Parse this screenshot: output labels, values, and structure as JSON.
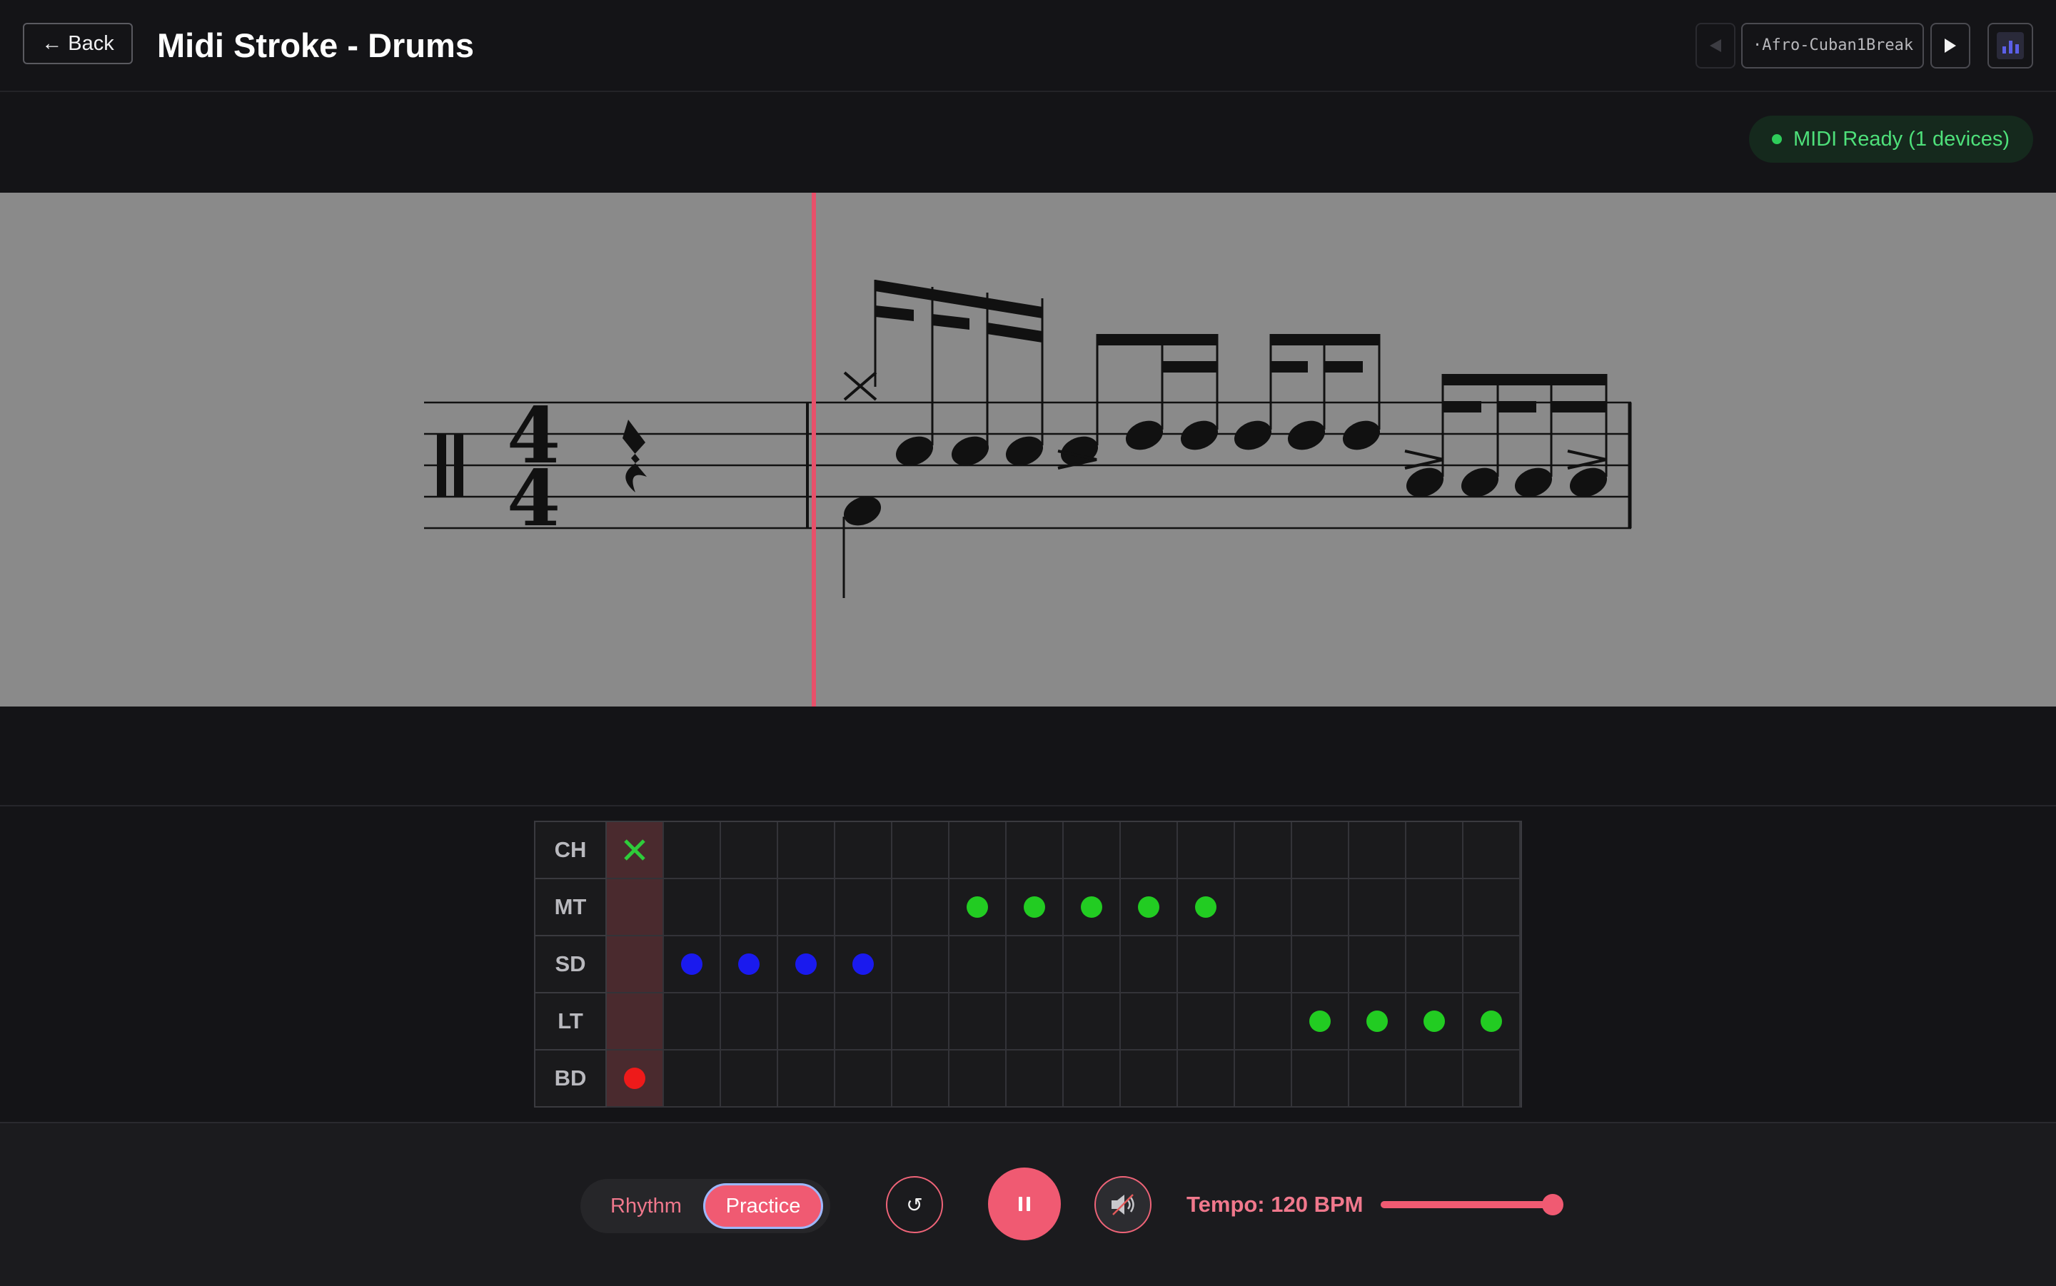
{
  "header": {
    "back_label": "← Back",
    "title": "Midi Stroke - Drums",
    "song_selector_value": "·Afro-Cuban1Break",
    "icons": {
      "prev": "triangle-left-icon",
      "next": "play-triangle-icon",
      "visualizer": "bar-chart-icon"
    }
  },
  "midi_status": {
    "text": "MIDI Ready (1 devices)",
    "color": "#2ecc5a"
  },
  "score": {
    "playhead_color": "#e8506a",
    "time_signature": "4/4"
  },
  "grid": {
    "columns": 16,
    "cursor_column": 0,
    "rows": [
      {
        "label": "CH",
        "hits": [
          {
            "step": 0,
            "kind": "x",
            "color": "#2ecc3a"
          }
        ]
      },
      {
        "label": "MT",
        "hits": [
          {
            "step": 6,
            "color": "#22cc22"
          },
          {
            "step": 7,
            "color": "#22cc22"
          },
          {
            "step": 8,
            "color": "#22cc22"
          },
          {
            "step": 9,
            "color": "#22cc22"
          },
          {
            "step": 10,
            "color": "#22cc22"
          }
        ]
      },
      {
        "label": "SD",
        "hits": [
          {
            "step": 1,
            "color": "#1a1aee"
          },
          {
            "step": 2,
            "color": "#1a1aee"
          },
          {
            "step": 3,
            "color": "#1a1aee"
          },
          {
            "step": 4,
            "color": "#1a1aee"
          }
        ]
      },
      {
        "label": "LT",
        "hits": [
          {
            "step": 12,
            "color": "#22cc22"
          },
          {
            "step": 13,
            "color": "#22cc22"
          },
          {
            "step": 14,
            "color": "#22cc22"
          },
          {
            "step": 15,
            "color": "#22cc22"
          }
        ]
      },
      {
        "label": "BD",
        "hits": [
          {
            "step": 0,
            "color": "#ee1a1a"
          }
        ]
      }
    ]
  },
  "controls": {
    "mode_options": [
      "Rhythm",
      "Practice"
    ],
    "mode_selected": "Practice",
    "restart_glyph": "↺",
    "restart_icon": "restart-icon",
    "pause_icon": "pause-icon",
    "mute_icon": "speaker-muted-icon",
    "tempo_label": "Tempo: 120 BPM",
    "tempo_fraction": 0.95,
    "accent_color": "#f05a72"
  }
}
